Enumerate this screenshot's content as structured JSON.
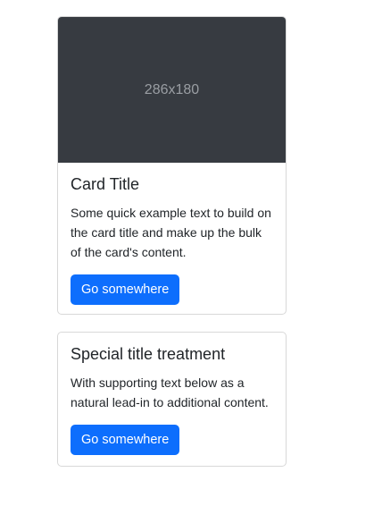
{
  "cards": [
    {
      "image_placeholder": "286x180",
      "title": "Card Title",
      "text": "Some quick example text to build on the card title and make up the bulk of the card's content.",
      "button_label": "Go somewhere"
    },
    {
      "title": "Special title treatment",
      "text": "With supporting text below as a natural lead-in to additional content.",
      "button_label": "Go somewhere"
    }
  ],
  "colors": {
    "primary": "#0d6efd",
    "image_bg": "#373b41",
    "image_text": "#9a9ea3"
  }
}
